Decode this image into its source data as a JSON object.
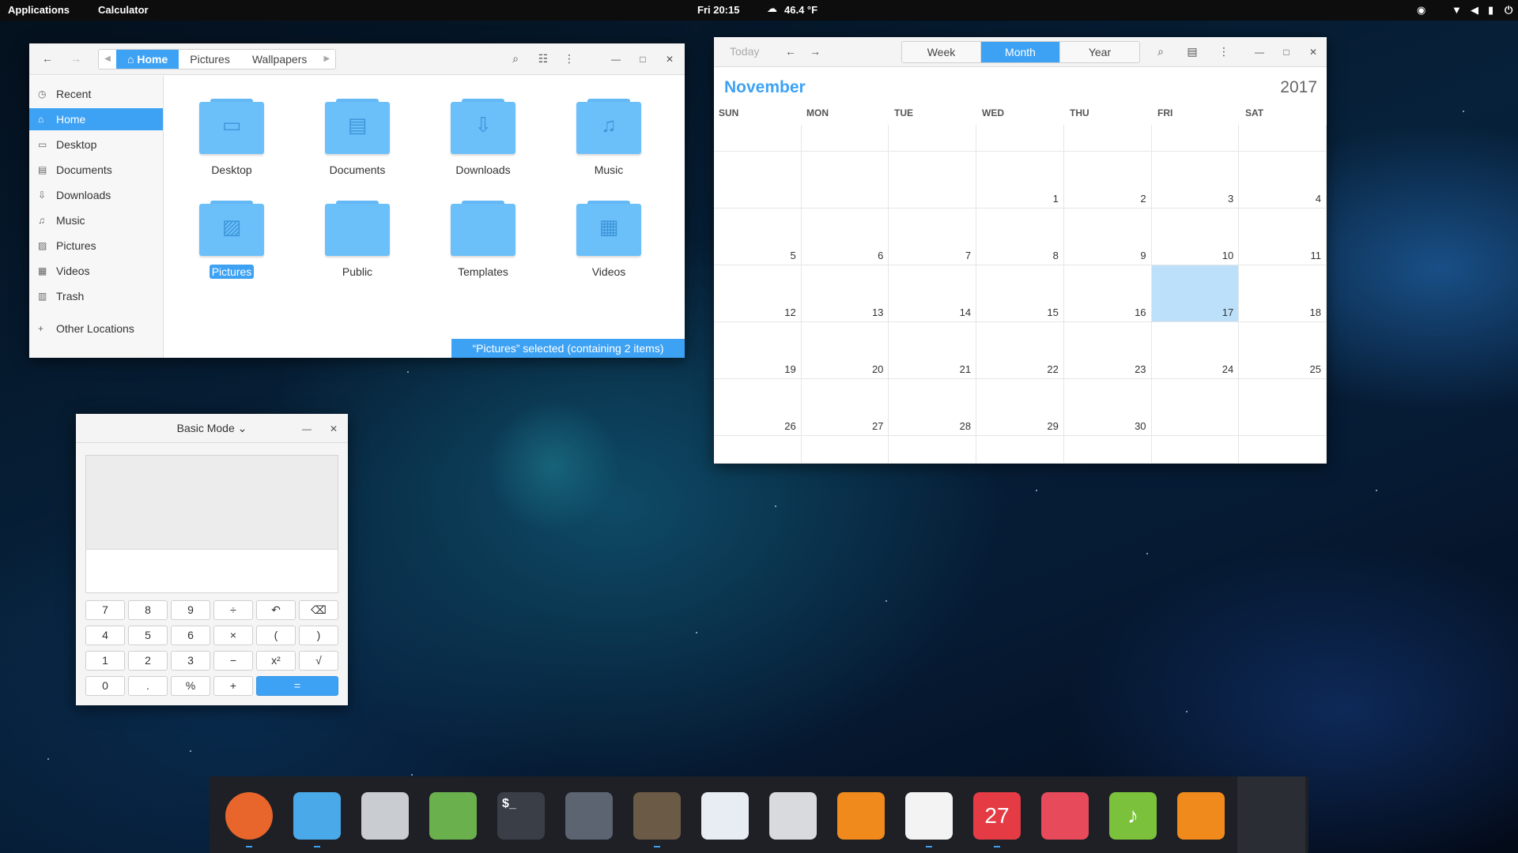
{
  "topbar": {
    "applications": "Applications",
    "app_name": "Calculator",
    "clock": "Fri 20:15",
    "weather": "46.4 °F"
  },
  "files": {
    "breadcrumbs": [
      "Home",
      "Pictures",
      "Wallpapers"
    ],
    "sidebar": [
      {
        "label": "Recent",
        "icon": "clock-icon"
      },
      {
        "label": "Home",
        "icon": "home-icon",
        "active": true
      },
      {
        "label": "Desktop",
        "icon": "desktop-icon"
      },
      {
        "label": "Documents",
        "icon": "document-icon"
      },
      {
        "label": "Downloads",
        "icon": "download-icon"
      },
      {
        "label": "Music",
        "icon": "music-icon"
      },
      {
        "label": "Pictures",
        "icon": "picture-icon"
      },
      {
        "label": "Videos",
        "icon": "video-icon"
      },
      {
        "label": "Trash",
        "icon": "trash-icon"
      },
      {
        "label": "Other Locations",
        "icon": "plus-icon"
      }
    ],
    "folders": [
      {
        "label": "Desktop",
        "icon": "desktop-icon"
      },
      {
        "label": "Documents",
        "icon": "document-icon"
      },
      {
        "label": "Downloads",
        "icon": "download-icon"
      },
      {
        "label": "Music",
        "icon": "music-icon"
      },
      {
        "label": "Pictures",
        "icon": "picture-icon",
        "selected": true
      },
      {
        "label": "Public",
        "icon": "folder-icon"
      },
      {
        "label": "Templates",
        "icon": "folder-icon"
      },
      {
        "label": "Videos",
        "icon": "video-icon"
      }
    ],
    "status": "“Pictures” selected  (containing 2 items)"
  },
  "calendar": {
    "today_label": "Today",
    "views": [
      "Week",
      "Month",
      "Year"
    ],
    "active_view": "Month",
    "month": "November",
    "year": "2017",
    "weekdays": [
      "SUN",
      "MON",
      "TUE",
      "WED",
      "THU",
      "FRI",
      "SAT"
    ],
    "weeks": [
      [
        "",
        "",
        "",
        "",
        "",
        "",
        ""
      ],
      [
        "",
        "",
        "",
        "1",
        "2",
        "3",
        "4"
      ],
      [
        "5",
        "6",
        "7",
        "8",
        "9",
        "10",
        "11"
      ],
      [
        "12",
        "13",
        "14",
        "15",
        "16",
        "17",
        "18"
      ],
      [
        "19",
        "20",
        "21",
        "22",
        "23",
        "24",
        "25"
      ],
      [
        "26",
        "27",
        "28",
        "29",
        "30",
        "",
        ""
      ],
      [
        "",
        "",
        "",
        "",
        "",
        "",
        ""
      ]
    ],
    "today": "17"
  },
  "calculator": {
    "mode": "Basic Mode",
    "keys": [
      [
        "7",
        "8",
        "9",
        "÷",
        "↶",
        "⌫"
      ],
      [
        "4",
        "5",
        "6",
        "×",
        "(",
        ")"
      ],
      [
        "1",
        "2",
        "3",
        "−",
        "x²",
        "√"
      ],
      [
        "0",
        ".",
        "%",
        "+",
        "="
      ]
    ]
  },
  "dock": {
    "apps": [
      {
        "name": "firefox-icon",
        "glyph": "",
        "color": "#e8652b",
        "running": true
      },
      {
        "name": "files-icon",
        "glyph": "",
        "color": "#4aa9e8",
        "running": true
      },
      {
        "name": "software-center-icon",
        "glyph": "",
        "color": "#c9cdd2",
        "running": false
      },
      {
        "name": "gnome-tweaks-icon",
        "glyph": "",
        "color": "#6ab04c",
        "running": false
      },
      {
        "name": "terminal-icon",
        "glyph": "$_",
        "color": "#3a3f47",
        "running": false
      },
      {
        "name": "screen-recorder-icon",
        "glyph": "",
        "color": "#5b6470",
        "running": false
      },
      {
        "name": "gimp-icon",
        "glyph": "",
        "color": "#6b5a45",
        "running": true
      },
      {
        "name": "text-editor-icon",
        "glyph": "",
        "color": "#e8ecf3",
        "running": false
      },
      {
        "name": "draw-icon",
        "glyph": "",
        "color": "#d8dade",
        "running": false
      },
      {
        "name": "vlc-icon",
        "glyph": "",
        "color": "#f08a1c",
        "running": false
      },
      {
        "name": "calculator-icon",
        "glyph": "",
        "color": "#f3f3f3",
        "running": true
      },
      {
        "name": "calendar-icon",
        "glyph": "27",
        "color": "#e43b44",
        "running": true
      },
      {
        "name": "equalizer-icon",
        "glyph": "",
        "color": "#e64a5b",
        "running": false
      },
      {
        "name": "music-player-icon",
        "glyph": "♪",
        "color": "#7bc13b",
        "running": false
      },
      {
        "name": "update-icon",
        "glyph": "",
        "color": "#f08a1c",
        "running": false
      },
      {
        "name": "app-grid-icon",
        "glyph": "",
        "color": "#2a2d33",
        "running": false
      }
    ]
  }
}
